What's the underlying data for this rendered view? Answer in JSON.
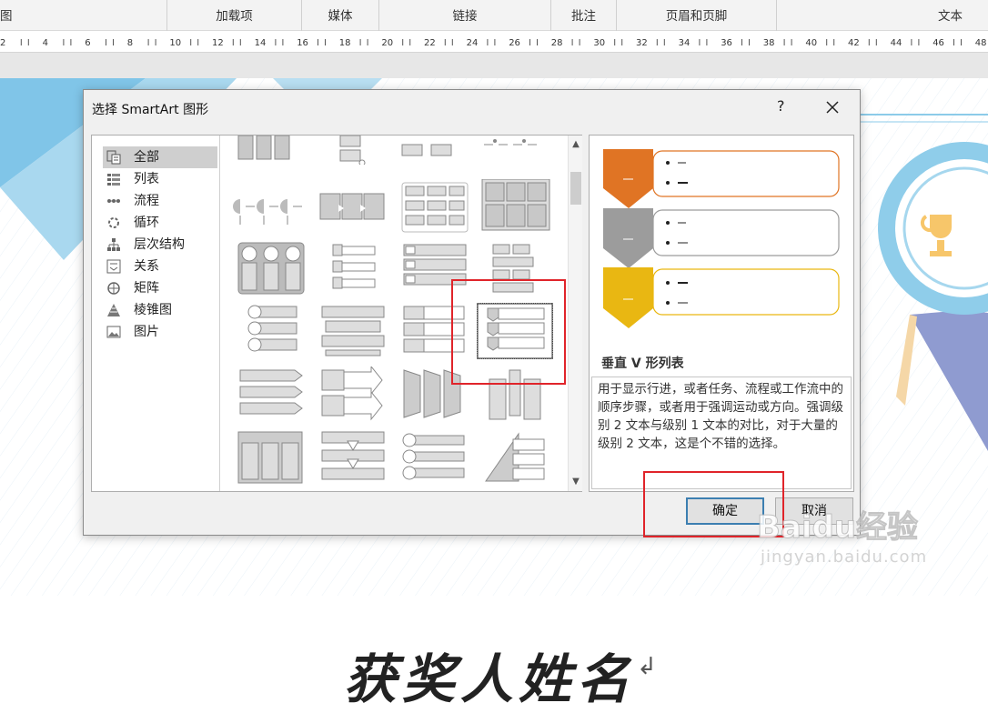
{
  "ribbon": {
    "groups": [
      "图",
      "加载项",
      "媒体",
      "链接",
      "批注",
      "页眉和页脚",
      "文本"
    ]
  },
  "ruler": {
    "marks": [
      "2",
      "4",
      "6",
      "8",
      "10",
      "12",
      "14",
      "16",
      "18",
      "20",
      "22",
      "24",
      "26",
      "28",
      "30",
      "32",
      "34",
      "36",
      "38",
      "40",
      "42",
      "44",
      "46",
      "48"
    ]
  },
  "document": {
    "title": "获奖人姓名",
    "mark": "↲"
  },
  "dialog": {
    "title": "选择 SmartArt 图形",
    "help_label": "?",
    "categories": [
      {
        "label": "全部",
        "icon": "all-layouts-icon"
      },
      {
        "label": "列表",
        "icon": "list-icon"
      },
      {
        "label": "流程",
        "icon": "process-icon"
      },
      {
        "label": "循环",
        "icon": "cycle-icon"
      },
      {
        "label": "层次结构",
        "icon": "hierarchy-icon"
      },
      {
        "label": "关系",
        "icon": "relationship-icon"
      },
      {
        "label": "矩阵",
        "icon": "matrix-icon"
      },
      {
        "label": "棱锥图",
        "icon": "pyramid-icon"
      },
      {
        "label": "图片",
        "icon": "picture-icon"
      }
    ],
    "selected_category": "全部",
    "preview": {
      "name": "垂直 V 形列表",
      "description": "用于显示行进，或者任务、流程或工作流中的顺序步骤，或者用于强调运动或方向。强调级别 2 文本与级别 1 文本的对比，对于大量的级别 2 文本，这是个不错的选择。",
      "chevron_colors": [
        "#e07424",
        "#9c9c9c",
        "#e9b712"
      ]
    },
    "ok_label": "确定",
    "cancel_label": "取消"
  },
  "watermark": {
    "brand": "Baidu经验",
    "url": "jingyan.baidu.com"
  },
  "colors": {
    "highlight_red": "#e0242a",
    "background_blue": "#7fc4e6"
  }
}
